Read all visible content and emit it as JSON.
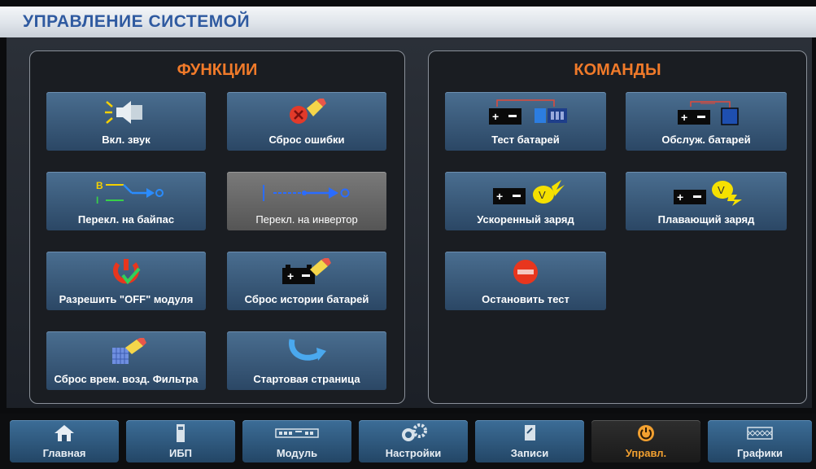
{
  "header": {
    "title": "УПРАВЛЕНИЕ СИСТЕМОЙ"
  },
  "functions": {
    "title": "ФУНКЦИИ",
    "items": [
      {
        "label": "Вкл. звук",
        "icon": "speaker-icon"
      },
      {
        "label": "Сброс ошибки",
        "icon": "reset-fault-icon"
      },
      {
        "label": "Перекл. на байпас",
        "icon": "bypass-icon"
      },
      {
        "label": "Перекл. на инвертор",
        "icon": "inverter-icon"
      },
      {
        "label": "Разрешить \"OFF\" модуля",
        "icon": "power-check-icon"
      },
      {
        "label": "Сброс истории батарей",
        "icon": "battery-history-reset-icon"
      },
      {
        "label": "Сброс врем. возд. Фильтра",
        "icon": "filter-reset-icon"
      },
      {
        "label": "Стартовая страница",
        "icon": "home-arrow-icon"
      }
    ]
  },
  "commands": {
    "title": "КОМАНДЫ",
    "items": [
      {
        "label": "Тест батарей",
        "icon": "battery-test-icon"
      },
      {
        "label": "Обслуж. батарей",
        "icon": "battery-service-icon"
      },
      {
        "label": "Ускоренный заряд",
        "icon": "boost-charge-icon"
      },
      {
        "label": "Плавающий заряд",
        "icon": "float-charge-icon"
      },
      {
        "label": "Остановить тест",
        "icon": "stop-icon"
      }
    ]
  },
  "nav": {
    "items": [
      {
        "label": "Главная",
        "icon": "home-icon"
      },
      {
        "label": "ИБП",
        "icon": "ups-icon"
      },
      {
        "label": "Модуль",
        "icon": "module-icon"
      },
      {
        "label": "Настройки",
        "icon": "gear-icon"
      },
      {
        "label": "Записи",
        "icon": "records-icon"
      },
      {
        "label": "Управл.",
        "icon": "power-icon"
      },
      {
        "label": "Графики",
        "icon": "graph-icon"
      }
    ],
    "active": "Управл."
  },
  "colors": {
    "accent_orange": "#f07a2a",
    "tile_blue": "#3a5a7c",
    "title_blue": "#2f5aa0",
    "nav_active_text": "#f2a030"
  }
}
